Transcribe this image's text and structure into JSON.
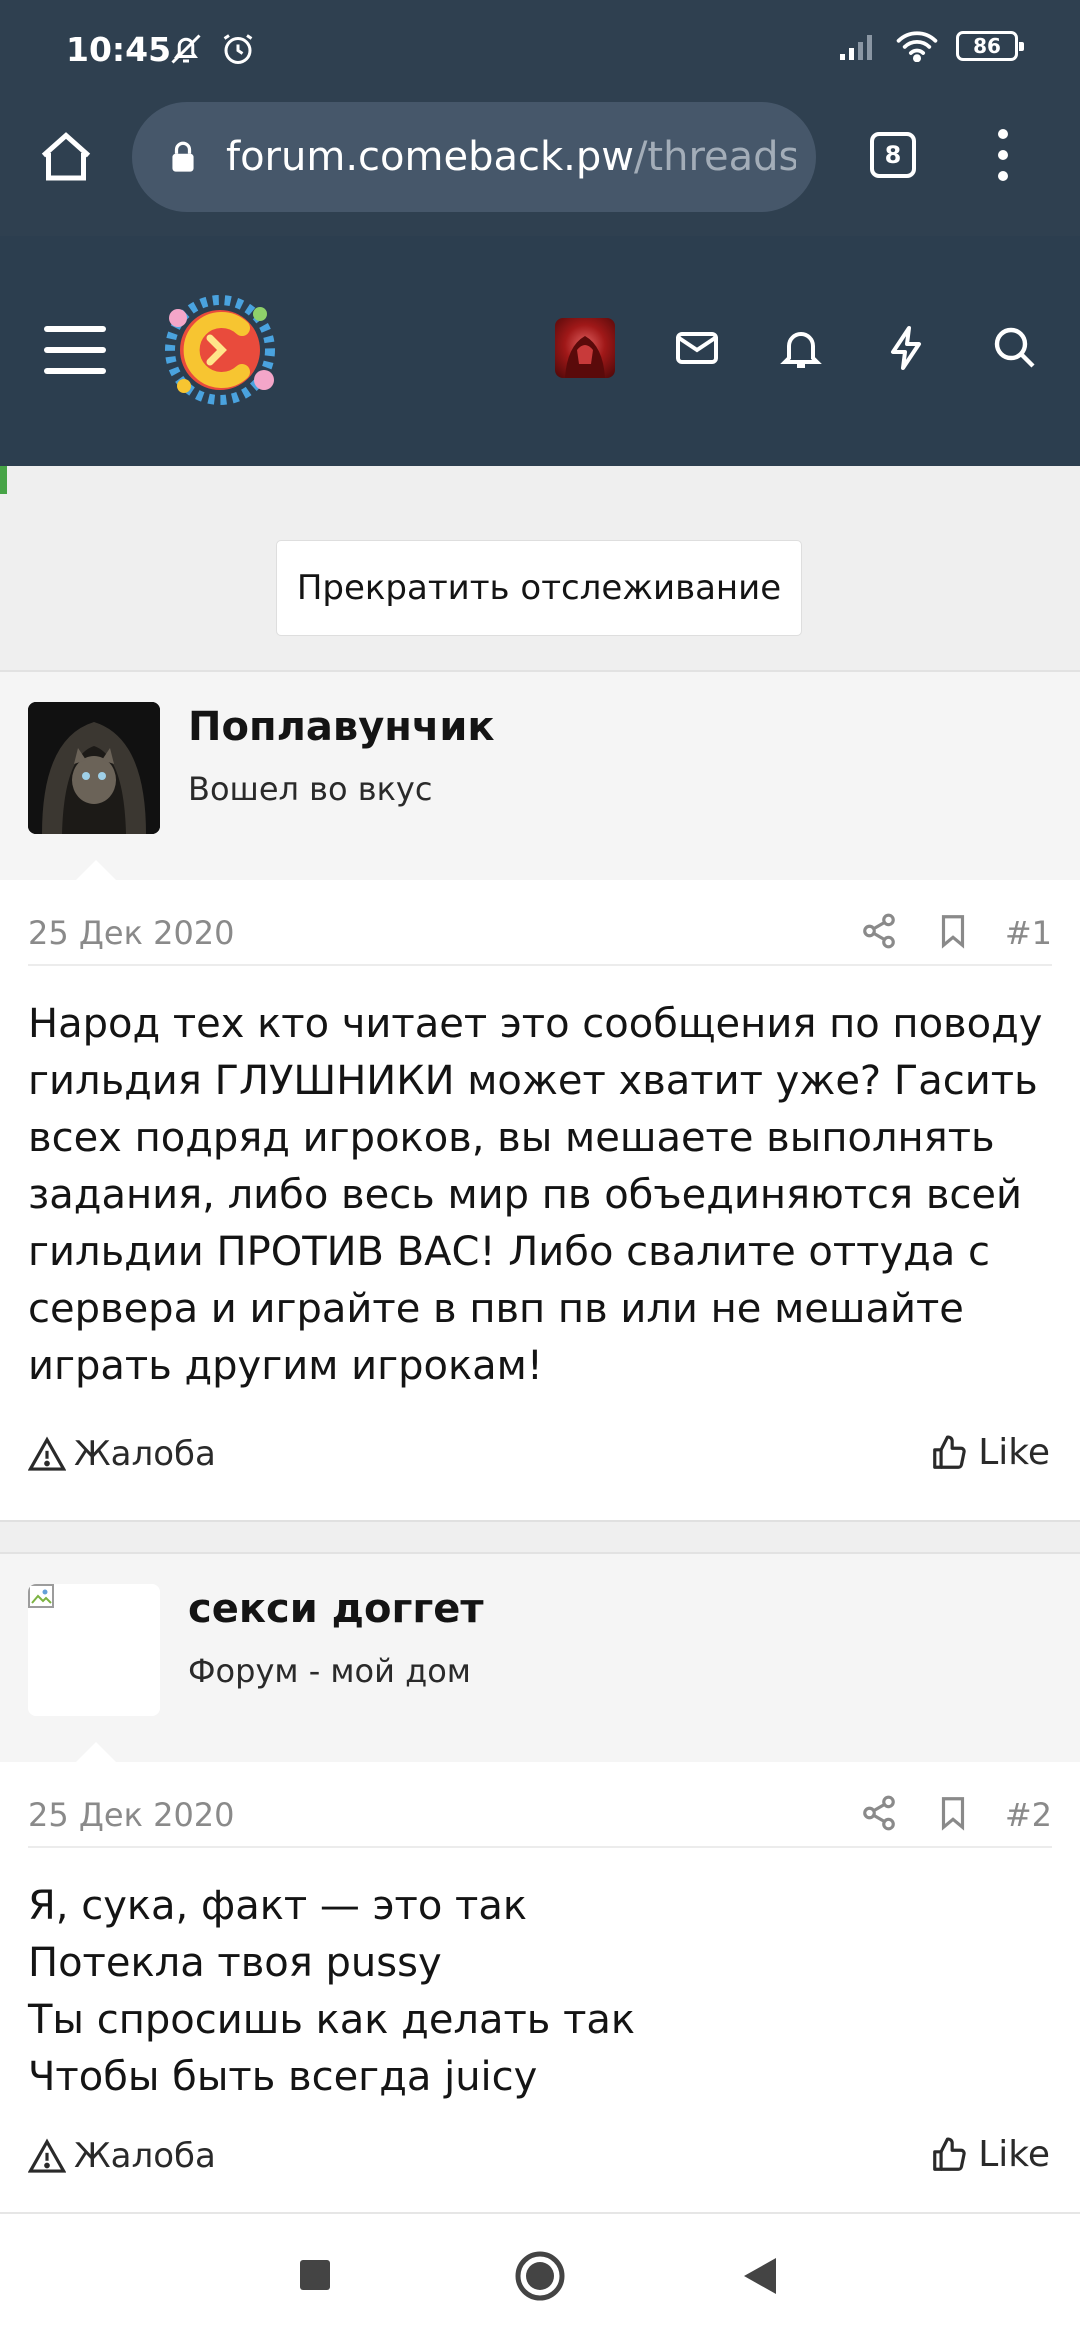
{
  "status_bar": {
    "time": "10:45",
    "battery": "86"
  },
  "browser": {
    "url_host": "forum.comeback.pw",
    "url_path": "/threads",
    "tab_count": "8"
  },
  "watch_button": {
    "label": "Прекратить отслеживание"
  },
  "posts": [
    {
      "username": "Поплавунчик",
      "user_title": "Вошел во вкус",
      "date": "25 Дек 2020",
      "number": "#1",
      "body": [
        "Народ тех кто читает это сообщения по поводу",
        "гильдия ГЛУШНИКИ может хватит уже? Гасить",
        "всех подряд игроков, вы мешаете выполнять",
        "задания, либо весь мир пв объединяются всей",
        "гильдии ПРОТИВ ВАС! Либо свалите оттуда с",
        "сервера и играйте в пвп пв или не мешайте",
        "играть другим игрокам!"
      ],
      "report_label": "Жалоба",
      "like_label": "Like"
    },
    {
      "username": "секси доггет",
      "user_title": "Форум - мой дом",
      "date": "25 Дек 2020",
      "number": "#2",
      "body": [
        "Я, сука, факт — это так",
        "Потекла твоя pussy",
        "Ты спросишь как делать так",
        "Чтобы быть всегда juicy"
      ],
      "report_label": "Жалоба",
      "like_label": "Like"
    }
  ],
  "colors": {
    "header_bg": "#2c3e4f",
    "status_bg": "#2f4050",
    "accent_green": "#47a447"
  }
}
